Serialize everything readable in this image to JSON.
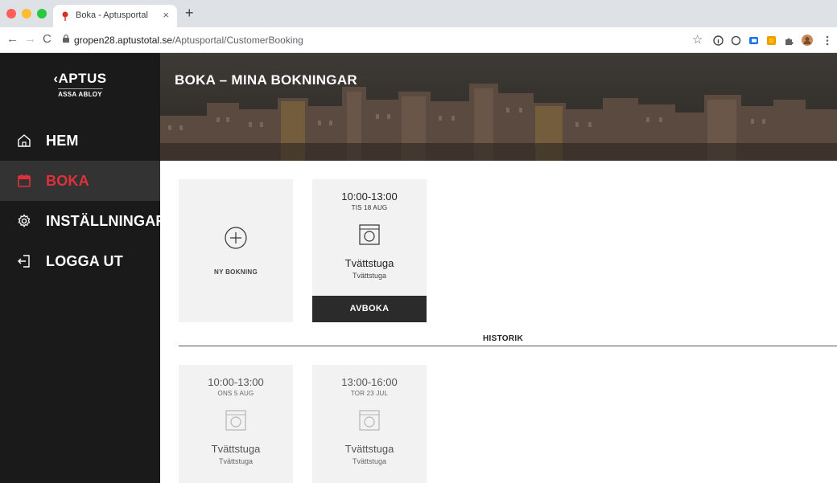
{
  "browser": {
    "tab_title": "Boka - Aptusportal",
    "tab_close": "×",
    "new_tab": "+",
    "url_host": "gropen28.aptustotal.se",
    "url_path": "/Aptusportal/CustomerBooking",
    "nav_back": "←",
    "nav_forward": "→",
    "nav_reload": "C",
    "bookmark_star": "☆"
  },
  "logo": {
    "main": "‹APTUS",
    "sub": "ASSA ABLOY"
  },
  "sidebar": {
    "items": [
      {
        "label": "HEM",
        "icon": "home-icon"
      },
      {
        "label": "BOKA",
        "icon": "calendar-icon",
        "active": true
      },
      {
        "label": "INSTÄLLNINGAR",
        "icon": "gear-icon"
      },
      {
        "label": "LOGGA UT",
        "icon": "logout-icon"
      }
    ],
    "accent_color": "#e0303a"
  },
  "header": {
    "title": "BOKA – MINA BOKNINGAR"
  },
  "new_booking": {
    "label": "NY BOKNING"
  },
  "bookings": [
    {
      "time": "10:00-13:00",
      "date": "TIS 18 AUG",
      "place": "Tvättstuga",
      "sub": "Tvättstuga",
      "action": "AVBOKA"
    }
  ],
  "history": {
    "title": "HISTORIK",
    "items": [
      {
        "time": "10:00-13:00",
        "date": "ONS 5 AUG",
        "place": "Tvättstuga",
        "sub": "Tvättstuga"
      },
      {
        "time": "13:00-16:00",
        "date": "TOR 23 JUL",
        "place": "Tvättstuga",
        "sub": "Tvättstuga"
      }
    ]
  }
}
